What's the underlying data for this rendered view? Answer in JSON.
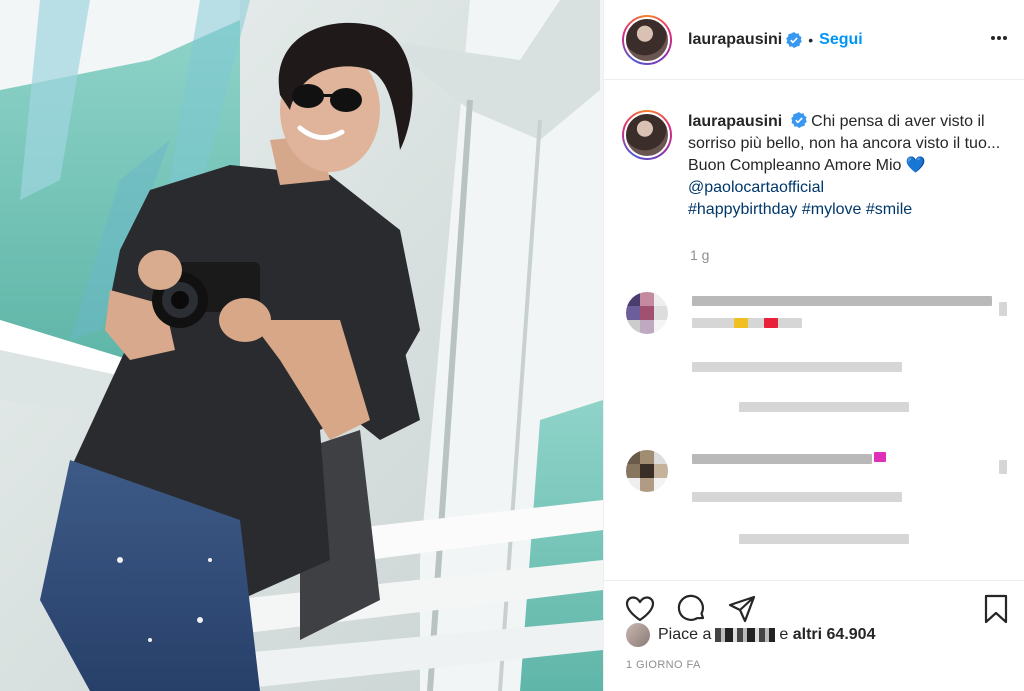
{
  "post": {
    "username": "laurapausini",
    "separator": "•",
    "follow_label": "Segui"
  },
  "caption": {
    "username": "laurapausini",
    "text": "Chi pensa di aver visto il sorriso più bello, non ha ancora visto il tuo... Buon Compleanno Amore Mio 💙",
    "mention": "@paolocartaofficial",
    "hashtags": [
      "#happybirthday",
      "#mylove",
      "#smile"
    ],
    "age": "1 g"
  },
  "likes": {
    "prefix": "Piace a",
    "middle": "e",
    "count_text": "altri 64.904"
  },
  "timestamp": "1 GIORNO FA",
  "colors": {
    "accent": "#0095f6",
    "link": "#00376b",
    "muted": "#8e8e8e",
    "text": "#262626"
  },
  "icons": {
    "more": "ellipsis-icon",
    "like": "heart-icon",
    "comment": "comment-icon",
    "share": "paper-plane-icon",
    "save": "bookmark-icon",
    "verified": "verified-badge-icon"
  }
}
